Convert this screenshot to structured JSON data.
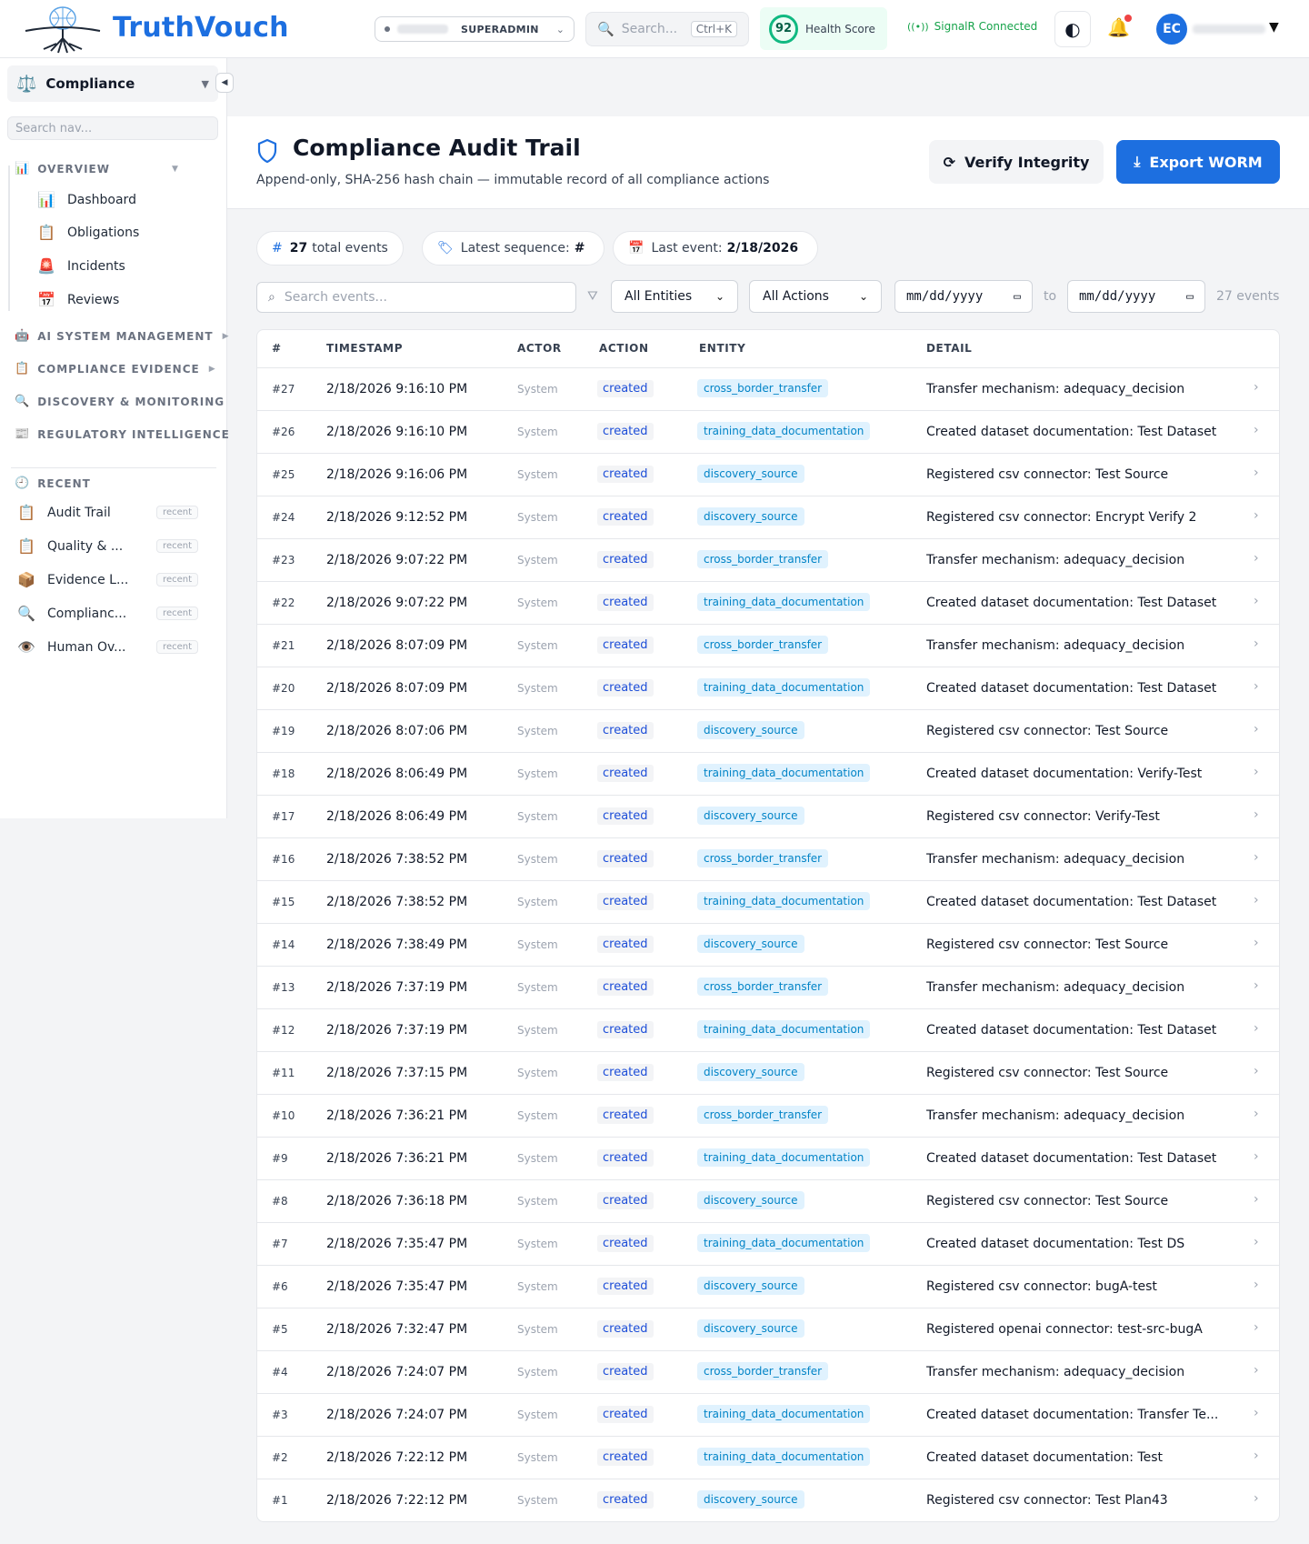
{
  "app": {
    "name": "TruthVouch"
  },
  "topbar": {
    "tenant_role": "SUPERADMIN",
    "search_placeholder": "Search...",
    "search_shortcut": "Ctrl+K",
    "health_score": "92",
    "health_label": "Health Score",
    "signalr_status": "SignalR Connected",
    "avatar_initials": "EC"
  },
  "sidebar": {
    "module": "Compliance",
    "nav_search_placeholder": "Search nav...",
    "sections": {
      "overview": "OVERVIEW",
      "ai_system": "AI SYSTEM MANAGEMENT",
      "evidence": "COMPLIANCE EVIDENCE",
      "discovery": "DISCOVERY & MONITORING",
      "regulatory": "REGULATORY INTELLIGENCE",
      "recent": "RECENT"
    },
    "overview_items": [
      "Dashboard",
      "Obligations",
      "Incidents",
      "Reviews"
    ],
    "recent_items": [
      "Audit Trail",
      "Quality & ...",
      "Evidence L...",
      "Complianc...",
      "Human Ov..."
    ],
    "recent_badge": "recent"
  },
  "page": {
    "title": "Compliance Audit Trail",
    "subtitle": "Append-only, SHA-256 hash chain — immutable record of all compliance actions",
    "verify_button": "Verify Integrity",
    "export_button": "Export WORM"
  },
  "stats": {
    "total_count": "27",
    "total_label": "total events",
    "seq_label": "Latest sequence:",
    "seq_value": "#",
    "last_label": "Last event:",
    "last_value": "2/18/2026"
  },
  "filters": {
    "search_placeholder": "Search events...",
    "entity_select": "All Entities",
    "action_select": "All Actions",
    "date_from": "mm/dd/yyyy",
    "date_to": "mm/dd/yyyy",
    "to_label": "to",
    "count_label": "27 events"
  },
  "table": {
    "headers": [
      "#",
      "TIMESTAMP",
      "ACTOR",
      "ACTION",
      "ENTITY",
      "DETAIL"
    ],
    "rows": [
      [
        "#27",
        "2/18/2026 9:16:10 PM",
        "System",
        "created",
        "cross_border_transfer",
        "Transfer mechanism: adequacy_decision"
      ],
      [
        "#26",
        "2/18/2026 9:16:10 PM",
        "System",
        "created",
        "training_data_documentation",
        "Created dataset documentation: Test Dataset"
      ],
      [
        "#25",
        "2/18/2026 9:16:06 PM",
        "System",
        "created",
        "discovery_source",
        "Registered csv connector: Test Source"
      ],
      [
        "#24",
        "2/18/2026 9:12:52 PM",
        "System",
        "created",
        "discovery_source",
        "Registered csv connector: Encrypt Verify 2"
      ],
      [
        "#23",
        "2/18/2026 9:07:22 PM",
        "System",
        "created",
        "cross_border_transfer",
        "Transfer mechanism: adequacy_decision"
      ],
      [
        "#22",
        "2/18/2026 9:07:22 PM",
        "System",
        "created",
        "training_data_documentation",
        "Created dataset documentation: Test Dataset"
      ],
      [
        "#21",
        "2/18/2026 8:07:09 PM",
        "System",
        "created",
        "cross_border_transfer",
        "Transfer mechanism: adequacy_decision"
      ],
      [
        "#20",
        "2/18/2026 8:07:09 PM",
        "System",
        "created",
        "training_data_documentation",
        "Created dataset documentation: Test Dataset"
      ],
      [
        "#19",
        "2/18/2026 8:07:06 PM",
        "System",
        "created",
        "discovery_source",
        "Registered csv connector: Test Source"
      ],
      [
        "#18",
        "2/18/2026 8:06:49 PM",
        "System",
        "created",
        "training_data_documentation",
        "Created dataset documentation: Verify-Test"
      ],
      [
        "#17",
        "2/18/2026 8:06:49 PM",
        "System",
        "created",
        "discovery_source",
        "Registered csv connector: Verify-Test"
      ],
      [
        "#16",
        "2/18/2026 7:38:52 PM",
        "System",
        "created",
        "cross_border_transfer",
        "Transfer mechanism: adequacy_decision"
      ],
      [
        "#15",
        "2/18/2026 7:38:52 PM",
        "System",
        "created",
        "training_data_documentation",
        "Created dataset documentation: Test Dataset"
      ],
      [
        "#14",
        "2/18/2026 7:38:49 PM",
        "System",
        "created",
        "discovery_source",
        "Registered csv connector: Test Source"
      ],
      [
        "#13",
        "2/18/2026 7:37:19 PM",
        "System",
        "created",
        "cross_border_transfer",
        "Transfer mechanism: adequacy_decision"
      ],
      [
        "#12",
        "2/18/2026 7:37:19 PM",
        "System",
        "created",
        "training_data_documentation",
        "Created dataset documentation: Test Dataset"
      ],
      [
        "#11",
        "2/18/2026 7:37:15 PM",
        "System",
        "created",
        "discovery_source",
        "Registered csv connector: Test Source"
      ],
      [
        "#10",
        "2/18/2026 7:36:21 PM",
        "System",
        "created",
        "cross_border_transfer",
        "Transfer mechanism: adequacy_decision"
      ],
      [
        "#9",
        "2/18/2026 7:36:21 PM",
        "System",
        "created",
        "training_data_documentation",
        "Created dataset documentation: Test Dataset"
      ],
      [
        "#8",
        "2/18/2026 7:36:18 PM",
        "System",
        "created",
        "discovery_source",
        "Registered csv connector: Test Source"
      ],
      [
        "#7",
        "2/18/2026 7:35:47 PM",
        "System",
        "created",
        "training_data_documentation",
        "Created dataset documentation: Test DS"
      ],
      [
        "#6",
        "2/18/2026 7:35:47 PM",
        "System",
        "created",
        "discovery_source",
        "Registered csv connector: bugA-test"
      ],
      [
        "#5",
        "2/18/2026 7:32:47 PM",
        "System",
        "created",
        "discovery_source",
        "Registered openai connector: test-src-bugA"
      ],
      [
        "#4",
        "2/18/2026 7:24:07 PM",
        "System",
        "created",
        "cross_border_transfer",
        "Transfer mechanism: adequacy_decision"
      ],
      [
        "#3",
        "2/18/2026 7:24:07 PM",
        "System",
        "created",
        "training_data_documentation",
        "Created dataset documentation: Transfer Te..."
      ],
      [
        "#2",
        "2/18/2026 7:22:12 PM",
        "System",
        "created",
        "training_data_documentation",
        "Created dataset documentation: Test"
      ],
      [
        "#1",
        "2/18/2026 7:22:12 PM",
        "System",
        "created",
        "discovery_source",
        "Registered csv connector: Test Plan43"
      ]
    ]
  },
  "colors": {
    "accent": "#1d6fe0",
    "success": "#10b981",
    "entity_badge_bg": "#e0f2fe",
    "entity_badge_text": "#0284c7"
  }
}
